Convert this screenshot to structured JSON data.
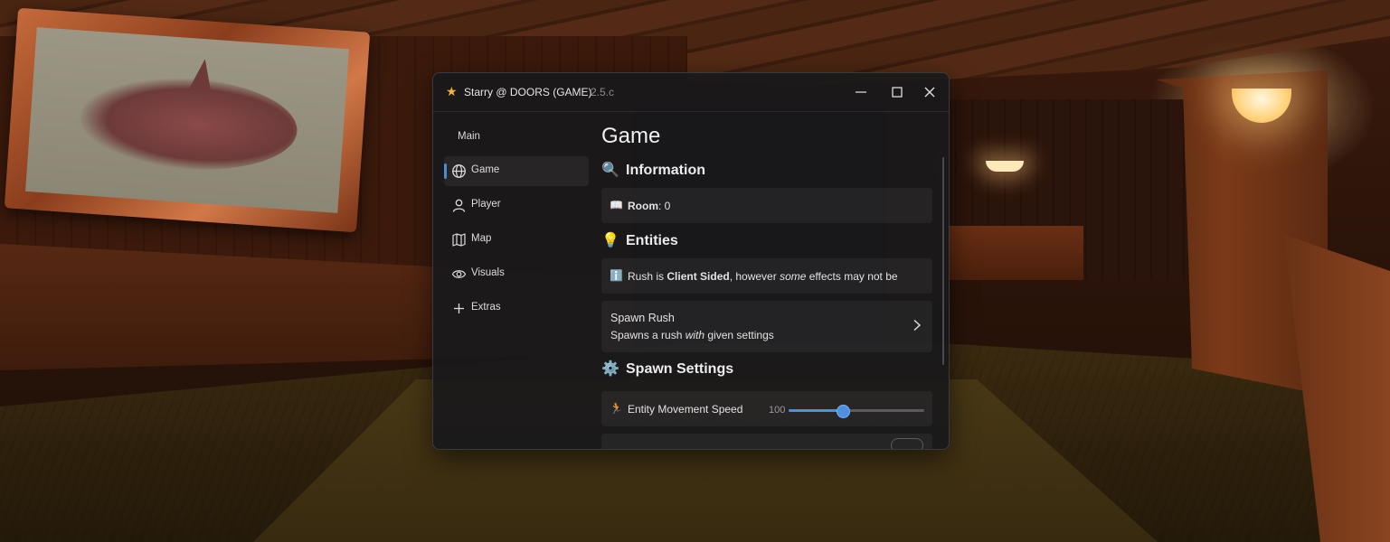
{
  "window": {
    "title": "Starry @ DOORS (GAME)",
    "version": "2.5.c",
    "buttons": {
      "minimize_icon": "minimize-icon",
      "maximize_icon": "maximize-icon",
      "close_icon": "close-icon"
    }
  },
  "sidebar": {
    "section_label": "Main",
    "active_index": 0,
    "items": [
      {
        "label": "Game",
        "icon": "globe-icon"
      },
      {
        "label": "Player",
        "icon": "user-icon"
      },
      {
        "label": "Map",
        "icon": "map-icon"
      },
      {
        "label": "Visuals",
        "icon": "eye-icon"
      },
      {
        "label": "Extras",
        "icon": "plus-icon"
      }
    ]
  },
  "page": {
    "title": "Game",
    "sections": {
      "information": {
        "heading": "Information",
        "emoji": "🔍",
        "room": {
          "emoji": "📖",
          "label": "Room",
          "value": ": 0"
        }
      },
      "entities": {
        "heading": "Entities",
        "emoji": "💡",
        "notice": {
          "emoji": "ℹ️",
          "prefix": "Rush is ",
          "bold": "Client Sided",
          "middle": ", however ",
          "italic": "some",
          "suffix": " effects may not be"
        },
        "spawn": {
          "title": "Spawn Rush",
          "desc_prefix": "Spawns a rush ",
          "desc_italic": "with",
          "desc_suffix": " given settings"
        }
      },
      "spawn_settings": {
        "heading": "Spawn Settings",
        "emoji": "⚙️",
        "speed": {
          "emoji": "🏃",
          "label": "Entity Movement Speed",
          "value": "100",
          "fill_fraction": 0.39
        }
      }
    }
  },
  "colors": {
    "accent": "#4c8bd6",
    "star": "#f2b631",
    "window_bg": "#19191b"
  }
}
